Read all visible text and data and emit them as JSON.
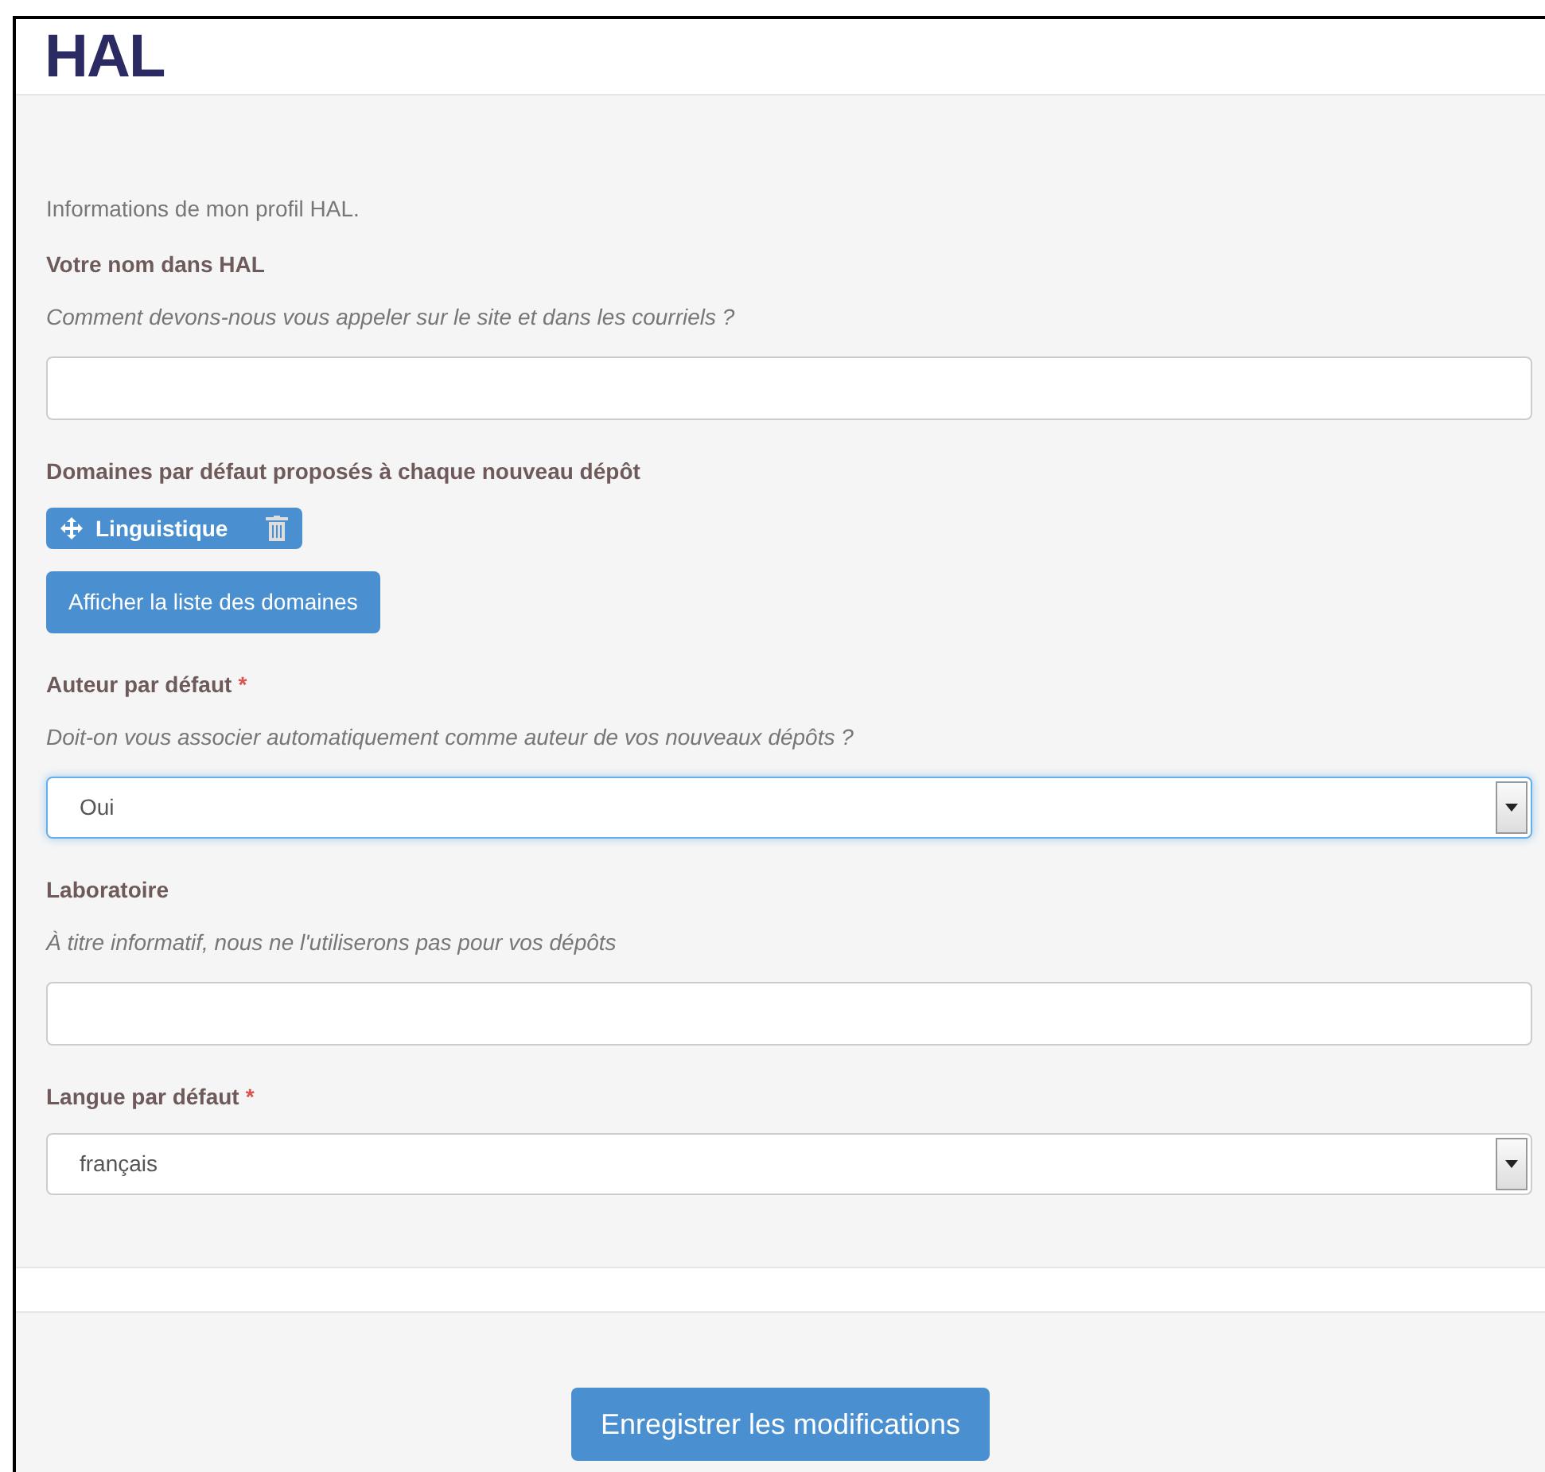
{
  "logo": "HAL",
  "intro": "Informations de mon profil HAL.",
  "fields": [
    {
      "kind": "text",
      "label": "Votre nom dans HAL",
      "help": "Comment devons-nous vous appeler sur le site et dans les courriels ?"
    },
    {
      "kind": "tags",
      "label": "Domaines par défaut proposés à chaque nouveau dépôt",
      "tags": [
        "Linguistique"
      ],
      "button": "Afficher la liste des domaines"
    },
    {
      "kind": "select",
      "label": "Auteur par défaut",
      "required_mark": "*",
      "help": "Doit-on vous associer automatiquement comme auteur de vos nouveaux dépôts ?",
      "value": "Oui",
      "focused": true
    },
    {
      "kind": "text",
      "label": "Laboratoire",
      "help": "À titre informatif, nous ne l'utiliserons pas pour vos dépôts"
    },
    {
      "kind": "select",
      "label": "Langue par défaut",
      "required_mark": "*",
      "value": "français",
      "focused": false
    }
  ],
  "submit": "Enregistrer les modifications"
}
